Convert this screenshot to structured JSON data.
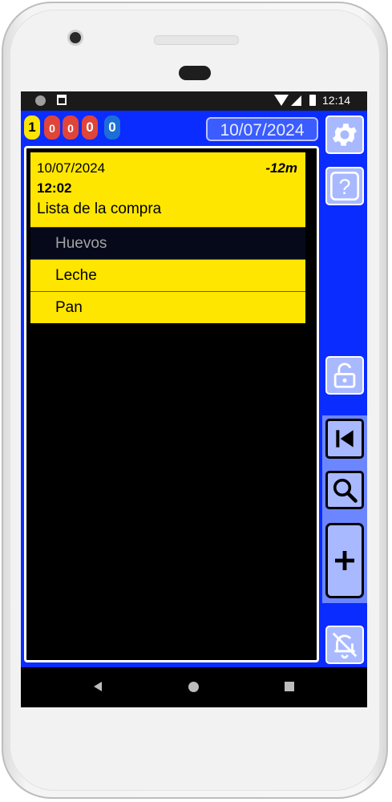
{
  "status_bar": {
    "time": "12:14"
  },
  "counters": {
    "yellow": "1",
    "red_a": "0",
    "red_b": "0",
    "red_c": "0",
    "blue": "0"
  },
  "header": {
    "date": "10/07/2024"
  },
  "note": {
    "date": "10/07/2024",
    "delta": "-12m",
    "time": "12:02",
    "title": "Lista de la compra",
    "items": [
      {
        "label": "Huevos",
        "checked": true
      },
      {
        "label": "Leche",
        "checked": false
      },
      {
        "label": "Pan",
        "checked": false
      }
    ]
  },
  "colors": {
    "app_background": "#0a2cff",
    "note_yellow": "#ffe600",
    "badge_red": "#e0453a",
    "badge_blue": "#1d6fd8"
  },
  "icons": [
    "settings-gear-icon",
    "help-question-icon",
    "unlock-padlock-icon",
    "skip-to-first-icon",
    "search-magnifier-icon",
    "add-plus-icon",
    "notifications-off-bell-icon"
  ]
}
